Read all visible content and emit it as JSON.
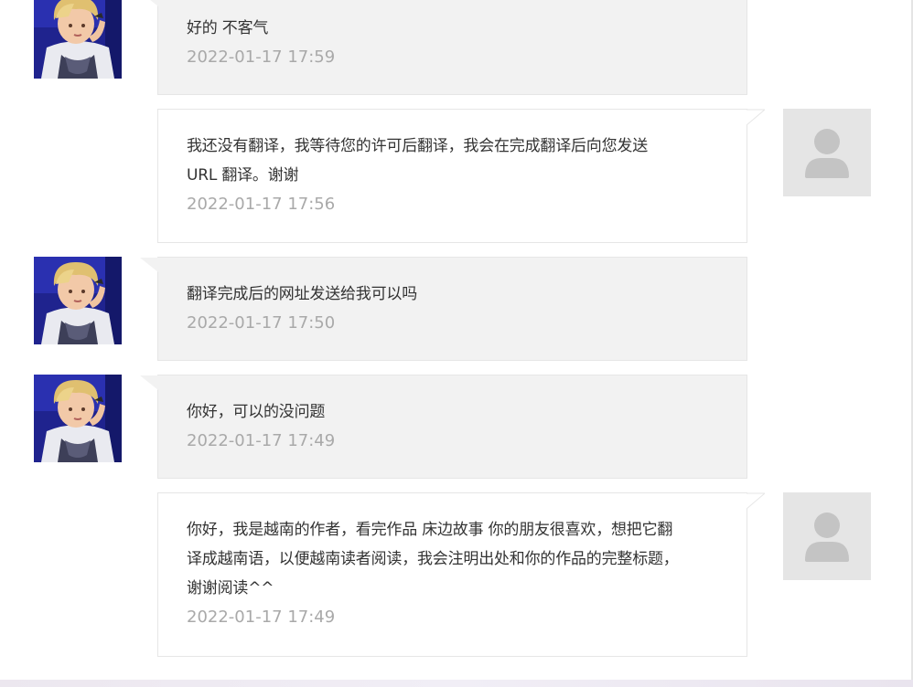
{
  "messages": [
    {
      "sender": "other",
      "avatar_icon": "user-photo-avatar-icon",
      "text": "好的 不客气",
      "time": "2022-01-17 17:59"
    },
    {
      "sender": "self",
      "avatar_icon": "default-user-avatar-icon",
      "text_lines": [
        "我还没有翻译，我等待您的许可后翻译，我会在完成翻译后向您发送",
        "URL 翻译。谢谢"
      ],
      "time": "2022-01-17 17:56"
    },
    {
      "sender": "other",
      "avatar_icon": "user-photo-avatar-icon",
      "text": "翻译完成后的网址发送给我可以吗",
      "time": "2022-01-17 17:50"
    },
    {
      "sender": "other",
      "avatar_icon": "user-photo-avatar-icon",
      "text": "你好，可以的没问题",
      "time": "2022-01-17 17:49"
    },
    {
      "sender": "self",
      "avatar_icon": "default-user-avatar-icon",
      "text_lines": [
        "你好，我是越南的作者，看完作品 床边故事 你的朋友很喜欢，想把它翻",
        "译成越南语，以便越南读者阅读，我会注明出处和你的作品的完整标题，",
        "谢谢阅读^^"
      ],
      "time": "2022-01-17 17:49"
    }
  ],
  "colors": {
    "incoming_bubble": "#f2f2f2",
    "outgoing_bubble": "#ffffff",
    "bubble_border": "#e6e6e6",
    "text": "#333333",
    "timestamp": "#a9a9a9",
    "default_avatar_bg": "#e5e5e5",
    "default_avatar_fg": "#c4c4c4"
  }
}
